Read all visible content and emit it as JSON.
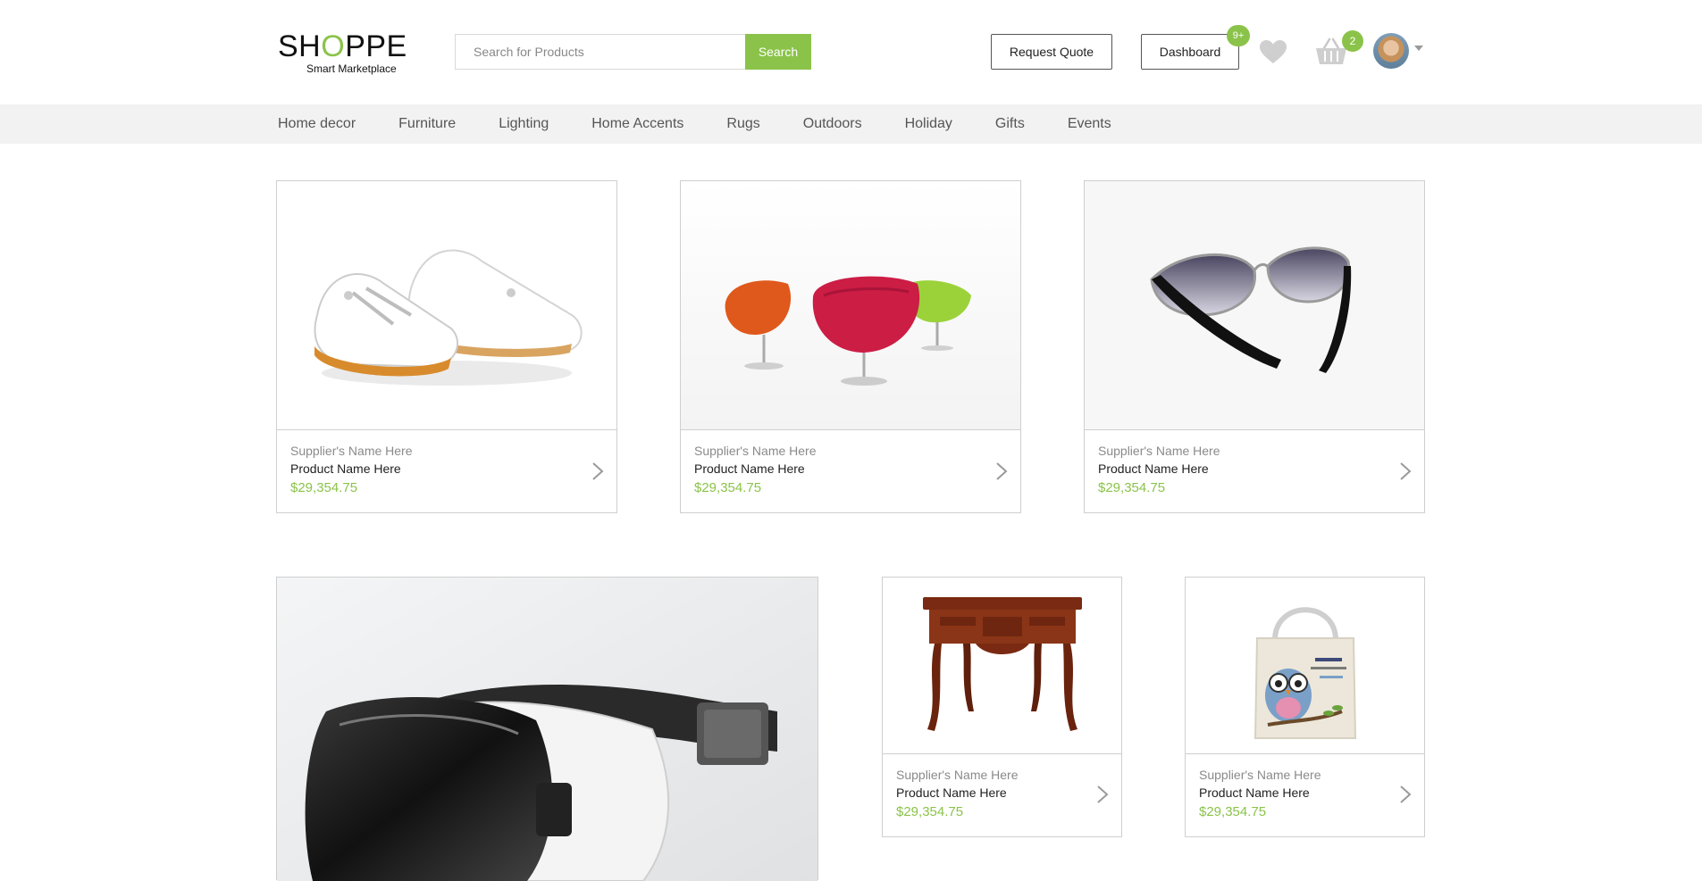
{
  "brand": {
    "name_pre": "SH",
    "name_o": "O",
    "name_post": "PPE",
    "tagline": "Smart Marketplace",
    "accent": "#8bc34a"
  },
  "search": {
    "placeholder": "Search for Products",
    "button": "Search"
  },
  "header": {
    "request_quote": "Request Quote",
    "dashboard": "Dashboard",
    "dashboard_badge": "9+",
    "cart_badge": "2",
    "icons": [
      "heart-icon",
      "basket-icon",
      "avatar",
      "caret-down-icon"
    ]
  },
  "nav": {
    "items": [
      "Home decor",
      "Furniture",
      "Lighting",
      "Home Accents",
      "Rugs",
      "Outdoors",
      "Holiday",
      "Gifts",
      "Events"
    ]
  },
  "products": [
    {
      "supplier": "Supplier's Name Here",
      "name": "Product Name Here",
      "price": "$29,354.75",
      "image": "white shoes"
    },
    {
      "supplier": "Supplier's Name Here",
      "name": "Product Name Here",
      "price": "$29,354.75",
      "image": "three chairs"
    },
    {
      "supplier": "Supplier's Name Here",
      "name": "Product Name Here",
      "price": "$29,354.75",
      "image": "aviator sunglasses"
    },
    {
      "image": "vr headset"
    },
    {
      "supplier": "Supplier's Name Here",
      "name": "Product Name Here",
      "price": "$29,354.75",
      "image": "wooden side table"
    },
    {
      "supplier": "Supplier's Name Here",
      "name": "Product Name Here",
      "price": "$29,354.75",
      "image": "owl tote bag"
    }
  ]
}
